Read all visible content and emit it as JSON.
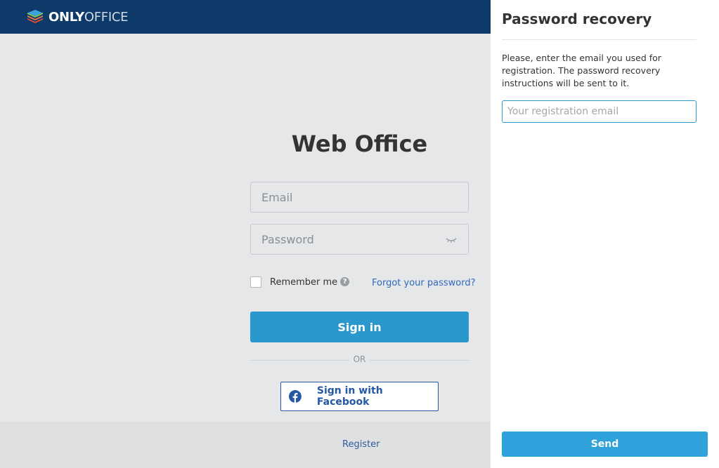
{
  "header": {
    "logo_text_only": "ONLY",
    "logo_text_office": "OFFICE",
    "background_color": "#0e3a6a"
  },
  "login": {
    "title": "Web Office",
    "email_placeholder": "Email",
    "password_placeholder": "Password",
    "remember_label": "Remember me",
    "remember_checked": false,
    "forgot_link": "Forgot your password?",
    "signin_label": "Sign in",
    "or_label": "OR",
    "facebook_label": "Sign in with Facebook",
    "register_link": "Register",
    "accent_color": "#2a97cd"
  },
  "recovery": {
    "title": "Password recovery",
    "description": "Please, enter the email you used for registration. The password recovery instructions will be sent to it.",
    "email_placeholder": "Your registration email",
    "email_value": "",
    "send_label": "Send"
  },
  "icons": {
    "logo": "onlyoffice-layers-icon",
    "eye": "eye-closed-icon",
    "help": "question-circle-icon",
    "facebook": "facebook-icon"
  }
}
